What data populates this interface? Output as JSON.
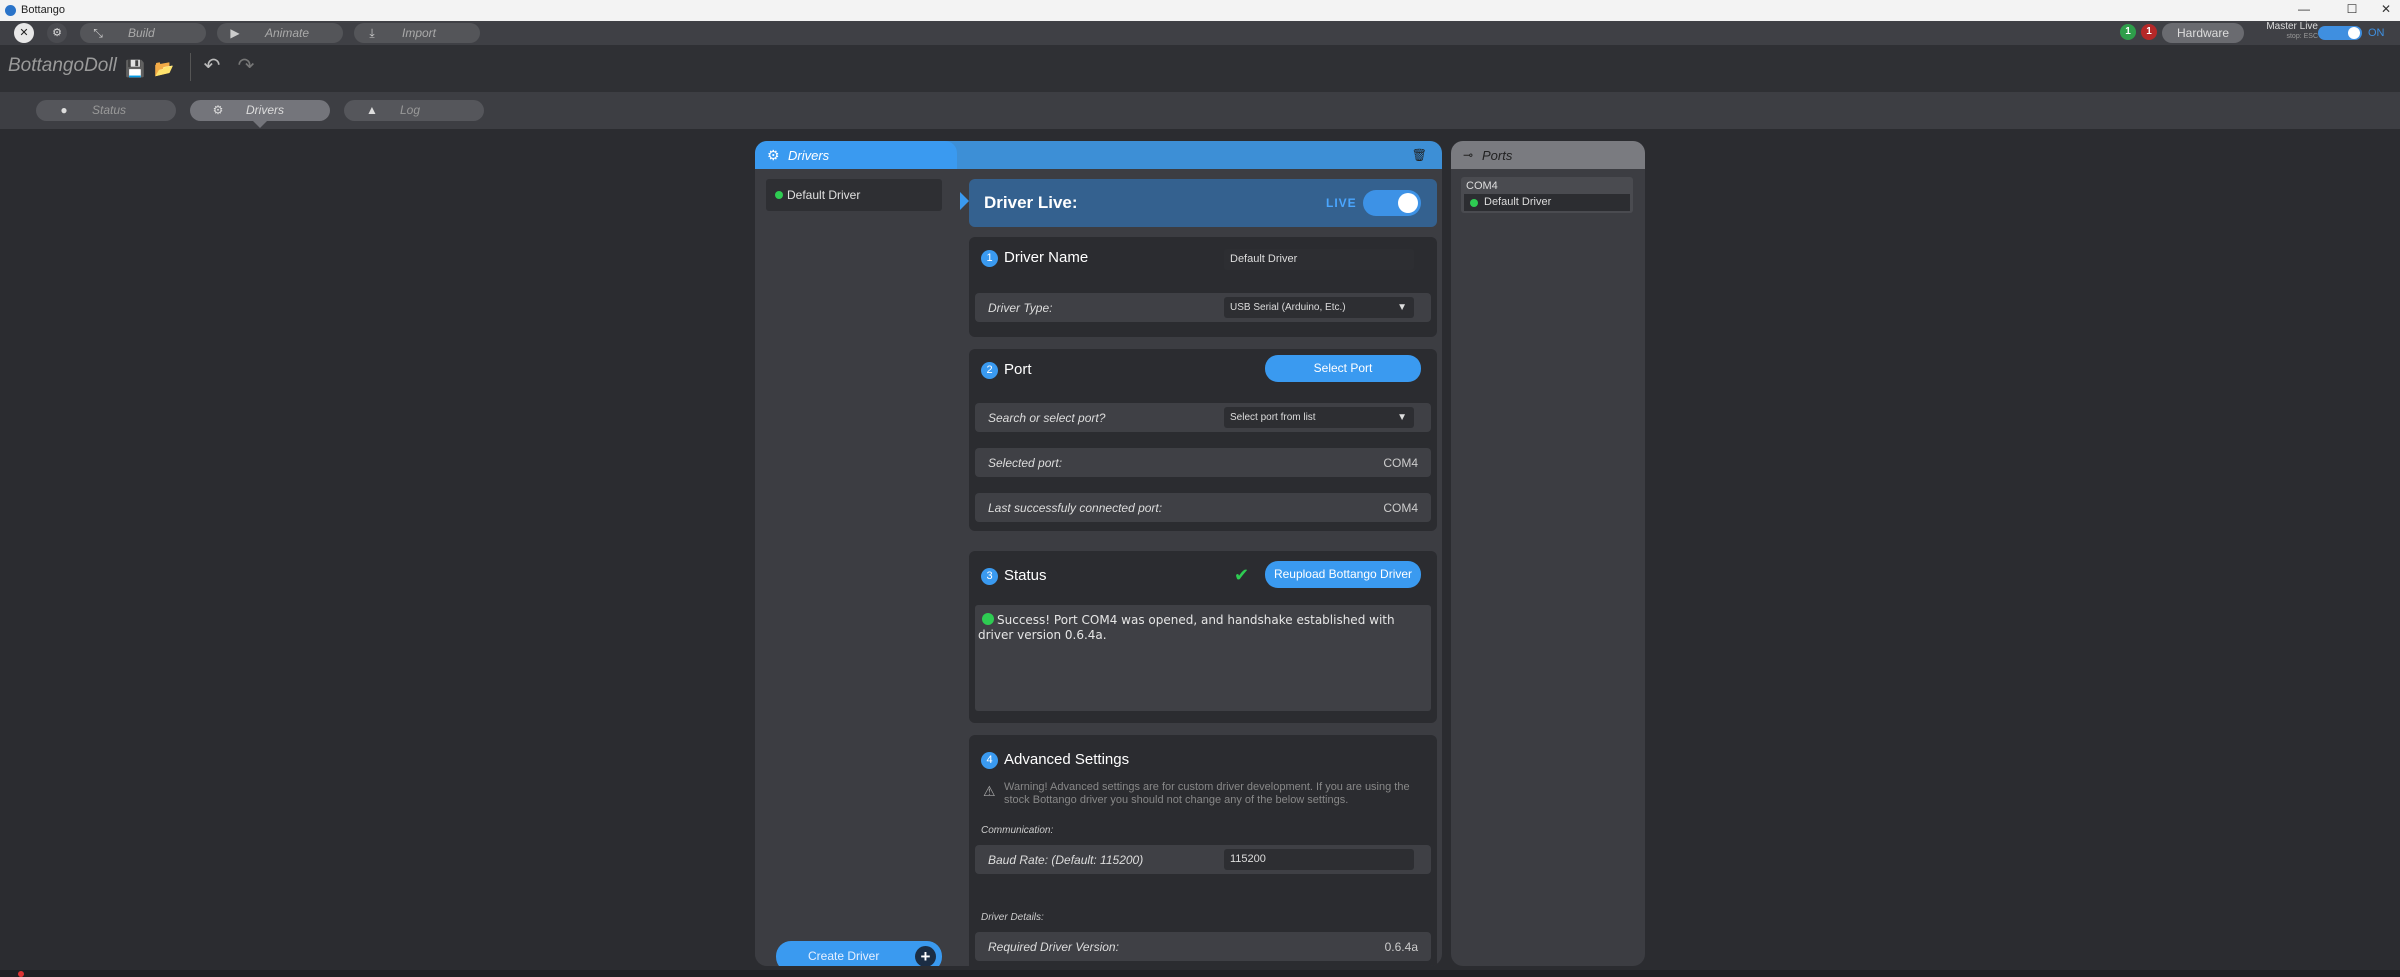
{
  "window": {
    "title": "Bottango",
    "minimize": "—",
    "maximize": "☐",
    "close": "✕"
  },
  "toolbar": {
    "close_glyph": "✕",
    "settings_glyph": "⚙",
    "modes": [
      {
        "label": "Build",
        "icon": "⤡"
      },
      {
        "label": "Animate",
        "icon": "▶"
      },
      {
        "label": "Import",
        "icon": "⤓"
      }
    ],
    "badge_ok": "1",
    "badge_err": "1",
    "hardware_label": "Hardware",
    "master_live_label": "Master Live",
    "master_live_sub": "stop: ESC",
    "master_live_state": "ON",
    "accent_color": "#3a9af0"
  },
  "project": {
    "name": "BottangoDoll",
    "save_icon": "💾",
    "open_icon": "📂",
    "undo_icon": "↶",
    "redo_icon": "↷"
  },
  "subtabs": [
    {
      "label": "Status",
      "icon": "●"
    },
    {
      "label": "Drivers",
      "icon": "⚙"
    },
    {
      "label": "Log",
      "icon": "▲"
    }
  ],
  "drivers_panel": {
    "title": "Drivers",
    "title_icon": "⚙",
    "trash_icon": "🗑",
    "list": [
      {
        "name": "Default Driver",
        "status_color": "#2ecc52"
      }
    ],
    "create_label": "Create Driver",
    "create_icon": "+"
  },
  "driver_detail": {
    "live_label": "Driver Live:",
    "live_tag": "LIVE",
    "live_on": true,
    "sections": {
      "name": {
        "num": "1",
        "title": "Driver Name",
        "value": "Default Driver",
        "type_label": "Driver Type:",
        "type_value": "USB Serial (Arduino, Etc.)"
      },
      "port": {
        "num": "2",
        "title": "Port",
        "select_button": "Select Port",
        "search_label": "Search or select port?",
        "search_placeholder": "Select port from list",
        "selected_label": "Selected port:",
        "selected_value": "COM4",
        "last_label": "Last successfuly connected port:",
        "last_value": "COM4"
      },
      "status": {
        "num": "3",
        "title": "Status",
        "check_icon": "✔",
        "reupload_button": "Reupload Bottango Driver",
        "message": "Success! Port COM4 was opened, and handshake established with driver version 0.6.4a."
      },
      "advanced": {
        "num": "4",
        "title": "Advanced Settings",
        "warning_icon": "⚠",
        "warning": "Warning! Advanced settings are for custom driver development. If you are using the stock Bottango driver you should not change any of the below settings.",
        "communication_label": "Communication:",
        "baud_label": "Baud Rate: (Default: 115200)",
        "baud_value": "115200",
        "details_label": "Driver Details:",
        "required_label": "Required Driver Version:",
        "required_value": "0.6.4a"
      }
    }
  },
  "ports_panel": {
    "title": "Ports",
    "title_icon": "⊸",
    "groups": [
      {
        "port": "COM4",
        "drivers": [
          "Default Driver"
        ]
      }
    ]
  }
}
